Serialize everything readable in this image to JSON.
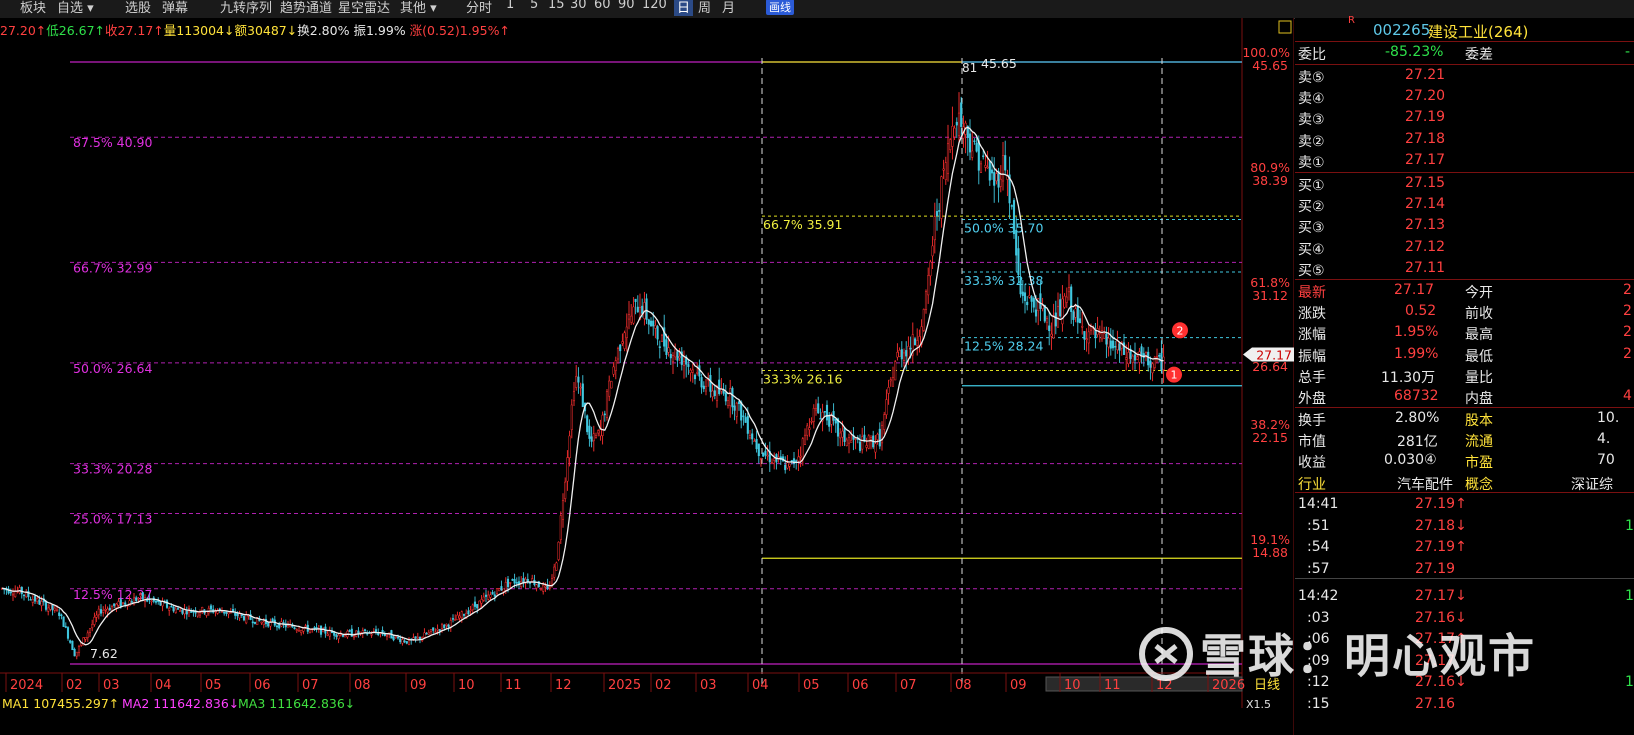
{
  "toolbar": {
    "items": [
      "板块",
      "自选 ▾",
      "选股",
      "弹幕",
      "九转序列",
      "趋势通道",
      "星空雷达",
      "其他 ▾",
      "分时",
      "1",
      "5",
      "15",
      "30",
      "60",
      "90",
      "120",
      "日",
      "周",
      "月",
      "画线"
    ],
    "active": "日",
    "highlight": "画线"
  },
  "info": {
    "open_hi": "27.20↑",
    "low": "低26.67↑",
    "close": "收27.17↑",
    "vol": "量113004↓",
    "amount": "额30487↓",
    "turnover": "换2.80%",
    "amplitude": "振1.99%",
    "change": "涨(0.52)1.95%↑"
  },
  "chart_data": {
    "type": "candlestick",
    "price_range": [
      7.62,
      45.65
    ],
    "last_price": "27.17",
    "x_labels": [
      "2024",
      "02",
      "03",
      "04",
      "05",
      "06",
      "07",
      "08",
      "09",
      "10",
      "11",
      "12",
      "2025",
      "02",
      "03",
      "04",
      "05",
      "06",
      "07",
      "08",
      "09",
      "10",
      "11",
      "12",
      "2026"
    ],
    "left_fib": [
      {
        "label": "87.5% 40.90",
        "value": 40.9
      },
      {
        "label": "66.7% 32.99",
        "value": 32.99
      },
      {
        "label": "50.0% 26.64",
        "value": 26.64
      },
      {
        "label": "33.3% 20.28",
        "value": 20.28
      },
      {
        "label": "25.0% 17.13",
        "value": 17.13
      },
      {
        "label": "12.5% 12.37",
        "value": 12.37
      }
    ],
    "yellow_fib": [
      {
        "label": "66.7% 35.91",
        "value": 35.91
      },
      {
        "label": "33.3% 26.16",
        "value": 26.16
      }
    ],
    "cyan_fib": [
      {
        "label": "50.0% 35.70",
        "value": 35.7
      },
      {
        "label": "33.3% 32.38",
        "value": 32.38
      },
      {
        "label": "12.5% 28.24",
        "value": 28.24
      }
    ],
    "right_axis": [
      {
        "pct": "100.0%",
        "val": "45.65"
      },
      {
        "pct": "80.9%",
        "val": "38.39"
      },
      {
        "pct": "61.8%",
        "val": "31.12"
      },
      {
        "pct": "",
        "val": "26.64"
      },
      {
        "pct": "38.2%",
        "val": "22.15"
      },
      {
        "pct": "19.1%",
        "val": "14.88"
      }
    ],
    "low_label": "7.62",
    "high_label": "45.65",
    "high_marker": "81",
    "ma_line": [
      "MA1 107455.297↑",
      "MA2 111642.836↓",
      "MA3 111642.836↓"
    ],
    "markers": [
      "1",
      "2"
    ],
    "bottom_label": "日线",
    "bottom_sub": "X1.5"
  },
  "stock": {
    "badge": "R",
    "code": "002265",
    "name": "建设工业(264)",
    "weibi_label": "委比",
    "weibi": "-85.23%",
    "weicha_label": "委差",
    "weicha": "-",
    "asks": [
      {
        "label": "卖⑤",
        "price": "27.21"
      },
      {
        "label": "卖④",
        "price": "27.20"
      },
      {
        "label": "卖③",
        "price": "27.19"
      },
      {
        "label": "卖②",
        "price": "27.18"
      },
      {
        "label": "卖①",
        "price": "27.17"
      }
    ],
    "bids": [
      {
        "label": "买①",
        "price": "27.15"
      },
      {
        "label": "买②",
        "price": "27.14"
      },
      {
        "label": "买③",
        "price": "27.13"
      },
      {
        "label": "买④",
        "price": "27.12"
      },
      {
        "label": "买⑤",
        "price": "27.11"
      }
    ],
    "quote": [
      {
        "l": "最新",
        "v": "27.17",
        "l2": "今开",
        "v2": "2"
      },
      {
        "l": "涨跌",
        "v": "0.52",
        "l2": "前收",
        "v2": "2"
      },
      {
        "l": "涨幅",
        "v": "1.95%",
        "l2": "最高",
        "v2": "2"
      },
      {
        "l": "振幅",
        "v": "1.99%",
        "l2": "最低",
        "v2": "2"
      },
      {
        "l": "总手",
        "v": "11.30万",
        "l2": "量比",
        "v2": ""
      },
      {
        "l": "外盘",
        "v": "68732",
        "l2": "内盘",
        "v2": "4"
      }
    ],
    "fund": [
      {
        "l": "换手",
        "v": "2.80%",
        "l2": "股本",
        "v2": "10."
      },
      {
        "l": "市值",
        "v": "281亿",
        "l2": "流通",
        "v2": "4."
      },
      {
        "l": "收益",
        "v": "0.030④",
        "l2": "市盈",
        "v2": "70"
      },
      {
        "l": "行业",
        "v": "汽车配件",
        "l2": "概念",
        "v2": "深证综"
      }
    ],
    "ticks": [
      {
        "t": "14:41",
        "p": "27.19↑",
        "c": "red",
        "v": ""
      },
      {
        "t": ":51",
        "p": "27.18↓",
        "c": "red",
        "v": "1"
      },
      {
        "t": ":54",
        "p": "27.19↑",
        "c": "red",
        "v": ""
      },
      {
        "t": ":57",
        "p": "27.19",
        "c": "red",
        "v": ""
      },
      {
        "t": "14:42",
        "p": "27.17↓",
        "c": "red",
        "v": "1"
      },
      {
        "t": ":03",
        "p": "27.16↓",
        "c": "red",
        "v": ""
      },
      {
        "t": ":06",
        "p": "27.17↑",
        "c": "red",
        "v": ""
      },
      {
        "t": ":09",
        "p": "27.17",
        "c": "red",
        "v": ""
      },
      {
        "t": ":12",
        "p": "27.16↓",
        "c": "red",
        "v": "1"
      },
      {
        "t": ":15",
        "p": "27.16",
        "c": "red",
        "v": ""
      }
    ]
  },
  "watermark": "雪球：明心观市"
}
